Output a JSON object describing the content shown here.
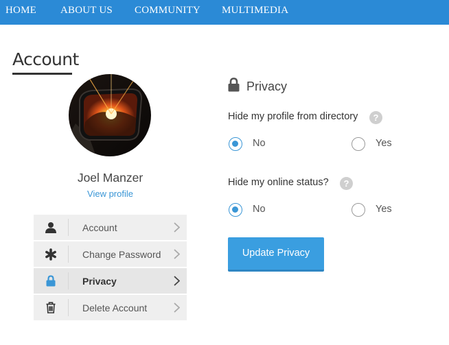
{
  "nav": {
    "items": [
      {
        "label": "HOME"
      },
      {
        "label": "ABOUT US"
      },
      {
        "label": "COMMUNITY"
      },
      {
        "label": "MULTIMEDIA"
      }
    ]
  },
  "page": {
    "title": "Account"
  },
  "profile": {
    "name": "Joel Manzer",
    "view_profile_label": "View profile"
  },
  "menu": {
    "items": [
      {
        "label": "Account",
        "icon": "user-icon",
        "active": false
      },
      {
        "label": "Change Password",
        "icon": "asterisk-icon",
        "active": false
      },
      {
        "label": "Privacy",
        "icon": "lock-icon",
        "active": true
      },
      {
        "label": "Delete Account",
        "icon": "trash-icon",
        "active": false
      }
    ]
  },
  "privacy": {
    "title": "Privacy",
    "questions": [
      {
        "label": "Hide my profile from directory",
        "help": "?",
        "options": [
          {
            "label": "No",
            "checked": true
          },
          {
            "label": "Yes",
            "checked": false
          }
        ]
      },
      {
        "label": "Hide my online status?",
        "help": "?",
        "options": [
          {
            "label": "No",
            "checked": true
          },
          {
            "label": "Yes",
            "checked": false
          }
        ]
      }
    ],
    "button_label": "Update Privacy"
  },
  "colors": {
    "nav_bg": "#2b8ad6",
    "accent": "#3a96d6",
    "button_bg": "#3a9ee0"
  }
}
